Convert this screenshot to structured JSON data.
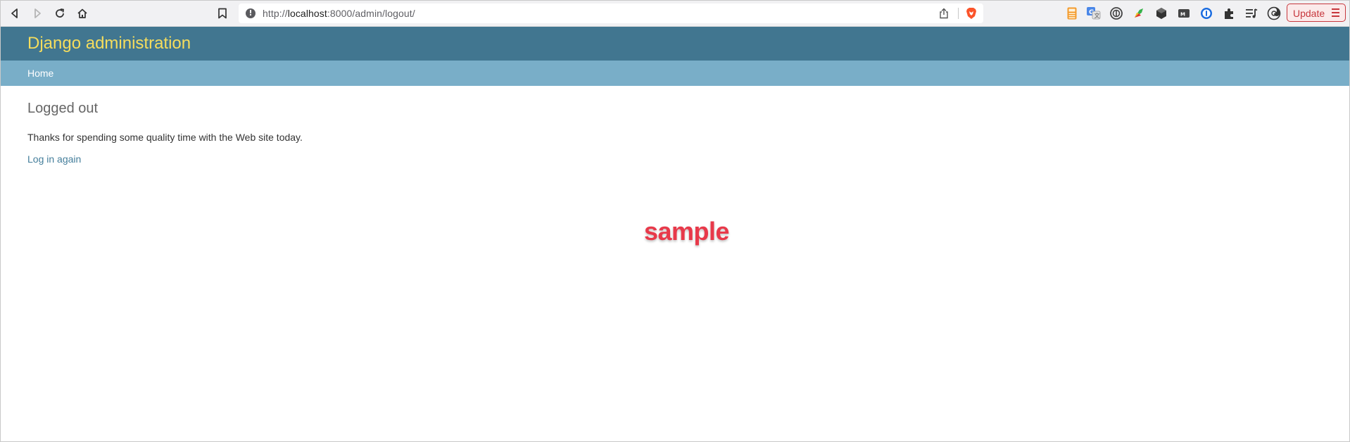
{
  "browser": {
    "url_prefix": "http://",
    "url_host": "localhost",
    "url_rest": ":8000/admin/logout/",
    "update_label": "Update",
    "icons": {
      "back": "back-arrow-icon",
      "forward": "forward-arrow-icon",
      "reload": "reload-icon",
      "home": "home-icon",
      "bookmark": "bookmark-icon",
      "site_info": "info-icon",
      "share": "share-icon",
      "brave": "brave-shield-icon",
      "extensions": [
        "calculator-extension-icon",
        "translate-extension-icon",
        "1password-extension-icon",
        "green-leaf-extension-icon",
        "dark-cube-extension-icon",
        "card-extension-icon",
        "password-manager-extension-icon",
        "puzzle-extensions-icon",
        "playlist-icon",
        "wallet-icon"
      ]
    }
  },
  "header": {
    "branding": "Django administration",
    "brand_color": "#f5dd5d",
    "header_color": "#417690"
  },
  "breadcrumbs": {
    "home": "Home",
    "color": "#79aec8"
  },
  "content": {
    "title": "Logged out",
    "message": "Thanks for spending some quality time with the Web site today.",
    "login_again": "Log in again"
  },
  "watermark": "sample"
}
